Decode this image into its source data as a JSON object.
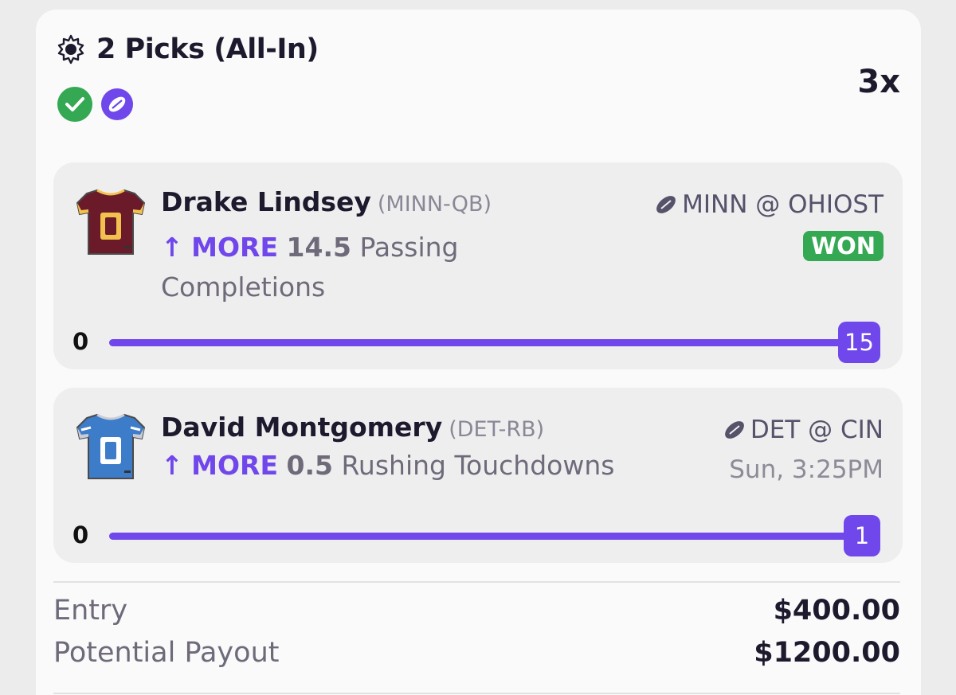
{
  "header": {
    "title": "2 Picks (All-In)",
    "multiplier": "3x",
    "icons": [
      "sun-icon",
      "check-circle-icon",
      "football-badge-icon"
    ]
  },
  "picks": [
    {
      "player": "Drake Lindsey",
      "team_pos": "(MINN-QB)",
      "direction_arrow": "↑",
      "direction": "MORE",
      "line": "14.5",
      "stat": "Passing Completions",
      "matchup": "MINN @ OHIOST",
      "status": "WON",
      "progress_start": "0",
      "progress_value": "15",
      "progress_fraction": 1.0,
      "jersey_number": "0",
      "colors": {
        "jersey_primary": "#6b1a2a",
        "jersey_accent": "#f2c14e"
      }
    },
    {
      "player": "David Montgomery",
      "team_pos": "(DET-RB)",
      "direction_arrow": "↑",
      "direction": "MORE",
      "line": "0.5",
      "stat": "Rushing Touchdowns",
      "matchup": "DET @ CIN",
      "game_time": "Sun, 3:25PM",
      "progress_start": "0",
      "progress_value": "1",
      "progress_fraction": 1.0,
      "jersey_number": "0",
      "colors": {
        "jersey_primary": "#3d7cc9",
        "jersey_accent": "#c7ccd6"
      }
    }
  ],
  "summary": {
    "entry_label": "Entry",
    "entry_value": "$400.00",
    "payout_label": "Potential Payout",
    "payout_value": "$1200.00"
  },
  "colors": {
    "accent": "#7047eb",
    "won": "#34a853",
    "check": "#34a853"
  }
}
